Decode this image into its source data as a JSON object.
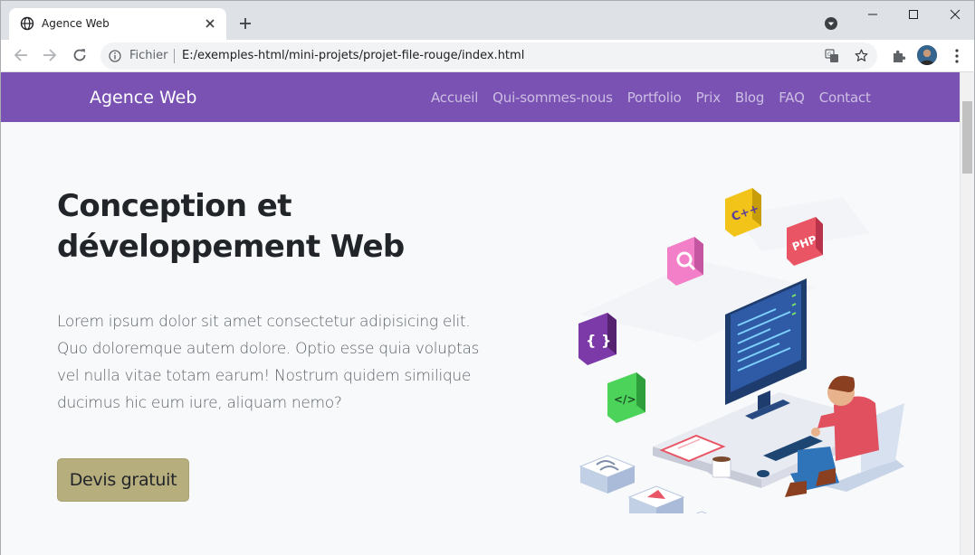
{
  "browser": {
    "tab_title": "Agence Web",
    "omnibox_scheme_label": "Fichier",
    "url": "E:/exemples-html/mini-projets/projet-file-rouge/index.html"
  },
  "site": {
    "brand": "Agence Web",
    "nav": [
      {
        "label": "Accueil"
      },
      {
        "label": "Qui-sommes-nous"
      },
      {
        "label": "Portfolio"
      },
      {
        "label": "Prix"
      },
      {
        "label": "Blog"
      },
      {
        "label": "FAQ"
      },
      {
        "label": "Contact"
      }
    ],
    "hero": {
      "title_line1": "Conception et",
      "title_line2": "développement Web",
      "text": "Lorem ipsum dolor sit amet consectetur adipisicing elit. Quo doloremque autem dolore. Optio esse quia voluptas vel nulla vitae totam earum! Nostrum quidem similique ducimus hic eum iure, aliquam nemo?",
      "cta_label": "Devis gratuit"
    },
    "illustration": {
      "badge_cpp": "C++",
      "badge_php": "PHP",
      "badge_braces": "{ }",
      "badge_tag": "</>"
    }
  },
  "colors": {
    "navbar": "#7952b3",
    "cta": "#b7ae7e",
    "page_bg": "#f8f9fa"
  },
  "icons": [
    "globe-icon",
    "close-icon",
    "plus-icon",
    "tab-search-icon",
    "back-icon",
    "forward-icon",
    "reload-icon",
    "info-icon",
    "translate-icon",
    "star-icon",
    "puzzle-icon",
    "avatar",
    "kebab-menu-icon"
  ]
}
